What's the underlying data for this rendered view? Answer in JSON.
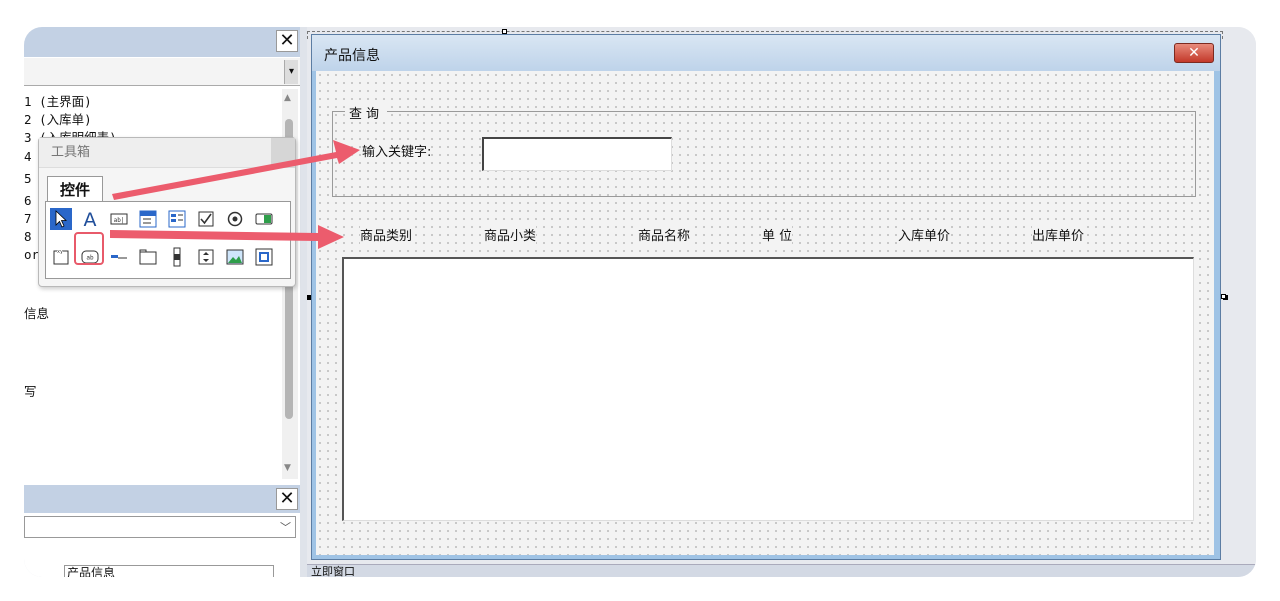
{
  "project_explorer": {
    "close_icon": "✕",
    "rows": [
      {
        "num": "1",
        "text": "(主界面)"
      },
      {
        "num": "2",
        "text": "(入库单)"
      },
      {
        "num": "3",
        "text": "(入库明细表)"
      },
      {
        "num": "4",
        "text": ""
      },
      {
        "num": "5",
        "text": ""
      },
      {
        "num": "6",
        "text": ""
      },
      {
        "num": "7",
        "text": ""
      },
      {
        "num": "8",
        "text": ""
      },
      {
        "num": "or",
        "text": ""
      }
    ],
    "partial_items": [
      "信息",
      "写"
    ]
  },
  "toolbox": {
    "title": "工具箱",
    "tab": "控件"
  },
  "properties": {
    "close_icon": "✕",
    "object_tab": "产品信息"
  },
  "userform": {
    "title": "产品信息",
    "close_icon": "✕",
    "frame_caption": "查询",
    "keyword_label": "输入关键字:",
    "columns": [
      "商品类别",
      "商品小类",
      "商品名称",
      "单 位",
      "入库单价",
      "出库单价"
    ]
  },
  "immediate_window": {
    "title": "立即窗口"
  },
  "colors": {
    "arrow": "#ec5c6d",
    "panel_title": "#c3d1e4",
    "form_border": "#9fc3e5"
  }
}
